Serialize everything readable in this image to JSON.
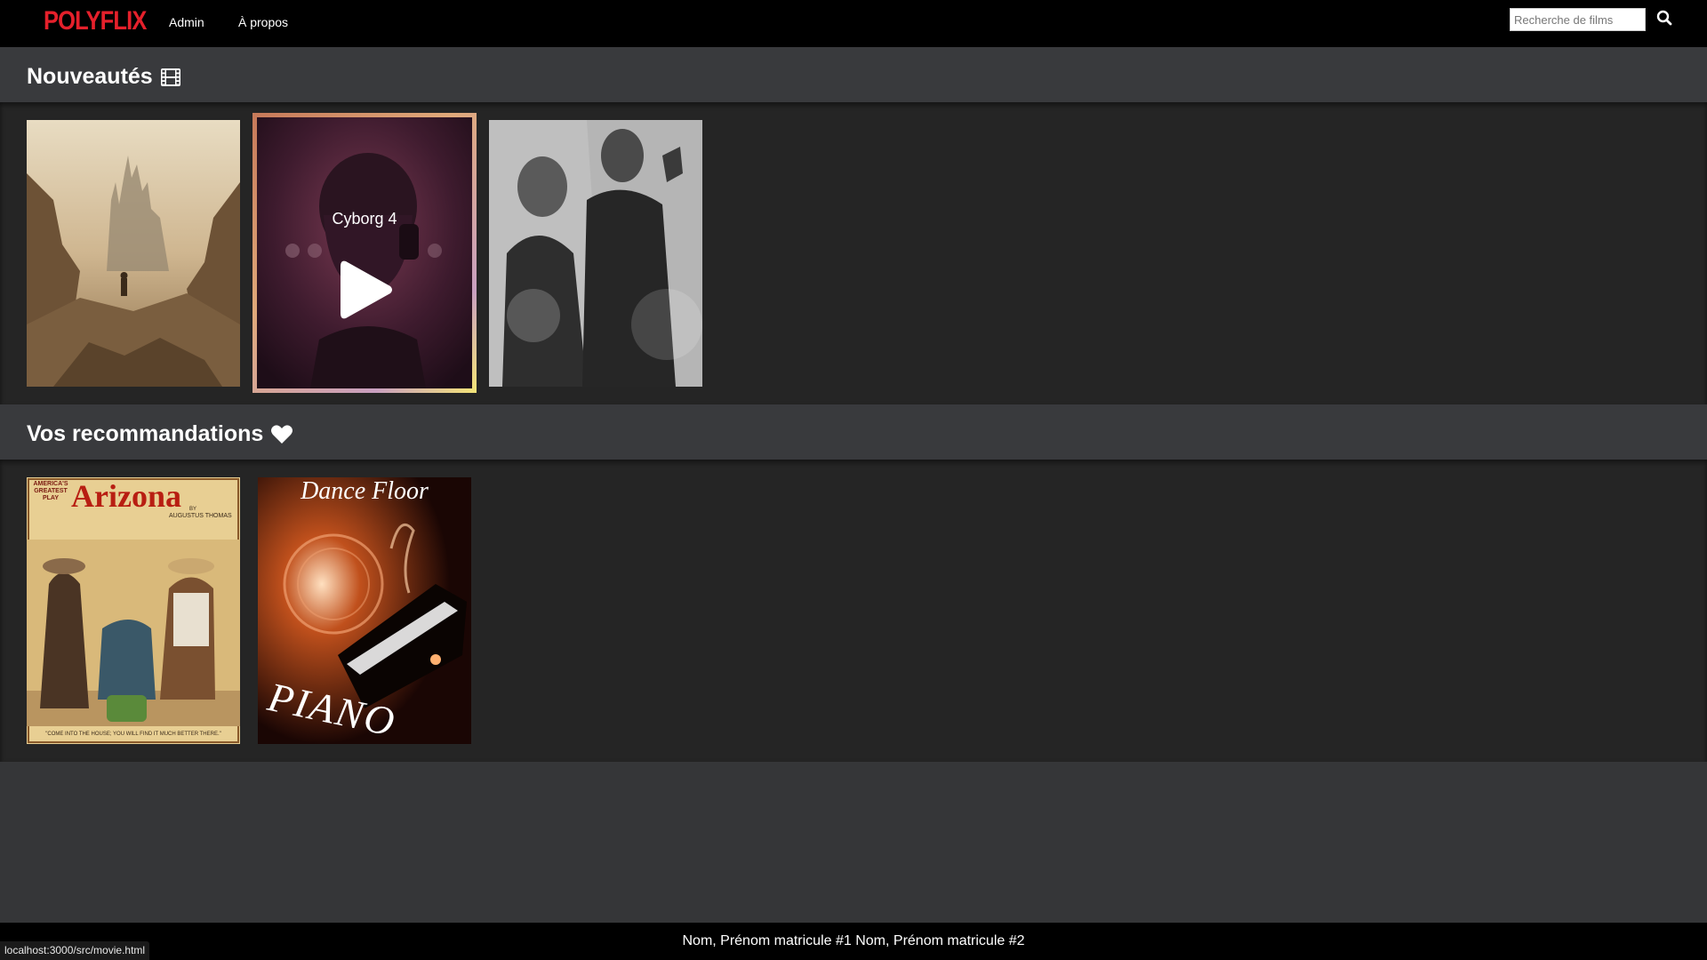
{
  "navbar": {
    "logo": "POLYFLIX",
    "links": [
      "Admin",
      "À propos"
    ],
    "search": {
      "placeholder": "Recherche de films",
      "value": ""
    },
    "search_icon": "search-icon"
  },
  "sections": [
    {
      "title": "Nouveautés",
      "icon": "film-icon",
      "movies": [
        {
          "poster": "desert-castle-poster",
          "title": ""
        },
        {
          "poster": "cyborg-poster",
          "title": "Cyborg 4",
          "hovered": true
        },
        {
          "poster": "noir-couple-poster",
          "title": ""
        }
      ]
    },
    {
      "title": "Vos recommandations",
      "icon": "heart-icon",
      "movies": [
        {
          "poster": "arizona-poster",
          "title": ""
        },
        {
          "poster": "dance-floor-poster",
          "title": ""
        }
      ]
    }
  ],
  "posters": {
    "arizona": {
      "tagline": "AMERICA'S GREATEST PLAY",
      "title": "Arizona",
      "by": "BY",
      "author": "AUGUSTUS THOMAS",
      "caption": "\"COME INTO THE HOUSE; YOU WILL FIND IT MUCH BETTER THERE.\""
    },
    "dance_floor": {
      "title": "Dance Floor",
      "subtitle": "PIANO"
    }
  },
  "footer": {
    "text": "Nom, Prénom matricule #1 Nom, Prénom matricule #2"
  },
  "status_bar": {
    "url": "localhost:3000/src/movie.html"
  },
  "colors": {
    "brand": "#e5202b",
    "navbar": "#000000",
    "section_header": "#393a3d",
    "section_row": "#252525",
    "page": "#353638"
  }
}
